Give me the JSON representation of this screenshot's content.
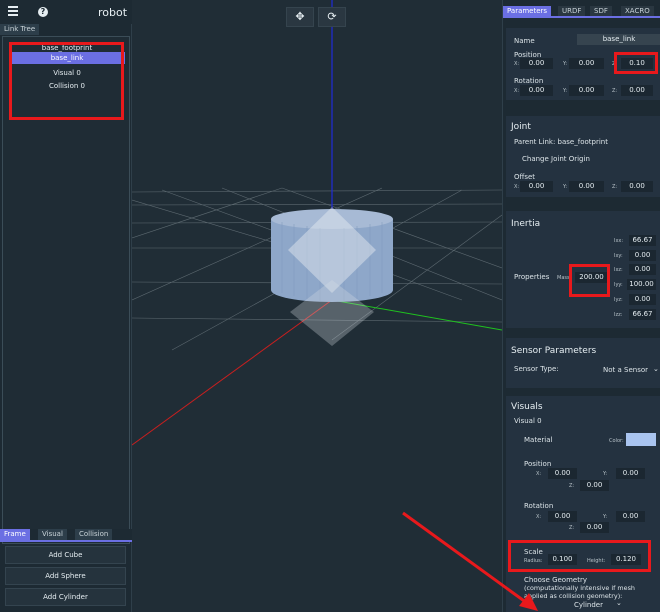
{
  "app": {
    "title": "robot"
  },
  "sidebar": {
    "tab": "Link Tree",
    "tree": [
      {
        "label": "base_footprint",
        "selected": false
      },
      {
        "label": "base_link",
        "selected": true
      },
      {
        "label": "Visual 0",
        "selected": false
      },
      {
        "label": "Collision 0",
        "selected": false
      }
    ],
    "bottom_tabs": [
      "Frame",
      "Visual",
      "Collision"
    ],
    "add_buttons": [
      "Add Cube",
      "Add Sphere",
      "Add Cylinder"
    ]
  },
  "viewport": {
    "move_icon": "move-icon",
    "rotate_icon": "refresh-icon"
  },
  "panel": {
    "tabs": [
      "Parameters",
      "URDF",
      "SDF",
      "XACRO"
    ],
    "name_label": "Name",
    "name_value": "base_link",
    "position": {
      "label": "Position",
      "x": "0.00",
      "y": "0.00",
      "z": "0.10"
    },
    "rotation": {
      "label": "Rotation",
      "x": "0.00",
      "y": "0.00",
      "z": "0.00"
    },
    "axis": {
      "x": "X:",
      "y": "Y:",
      "z": "Z:"
    },
    "joint": {
      "title": "Joint",
      "parent": "Parent Link: base_footprint",
      "change_origin": "Change Joint Origin",
      "offset_label": "Offset",
      "x": "0.00",
      "y": "0.00",
      "z": "0.00"
    },
    "inertia": {
      "title": "Inertia",
      "properties": "Properties",
      "mass_label": "Mass",
      "mass": "200.00",
      "ixx_label": "Ixx:",
      "ixx": "66.67",
      "ixy_label": "Ixy:",
      "ixy": "0.00",
      "ixz_label": "Ixz:",
      "ixz": "0.00",
      "iyy_label": "Iyy:",
      "iyy": "100.00",
      "iyz_label": "Iyz:",
      "iyz": "0.00",
      "izz_label": "Izz:",
      "izz": "66.67"
    },
    "sensor": {
      "title": "Sensor Parameters",
      "type_label": "Sensor Type:",
      "type_value": "Not a Sensor"
    },
    "visuals": {
      "title": "Visuals",
      "visual0": "Visual 0",
      "material_label": "Material",
      "color_label": "Color:",
      "color": "#a9c4ef",
      "position_label": "Position",
      "px": "0.00",
      "py": "0.00",
      "pz": "0.00",
      "rotation_label": "Rotation",
      "rx": "0.00",
      "ry": "0.00",
      "rz": "0.00",
      "scale_label": "Scale",
      "radius_label": "Radius:",
      "radius": "0.100",
      "height_label": "Height:",
      "height": "0.120",
      "geometry_label": "Choose Geometry",
      "geometry_note": "(computationally intensive if mesh applied as collision geometry):",
      "geometry_value": "Cylinder"
    }
  }
}
